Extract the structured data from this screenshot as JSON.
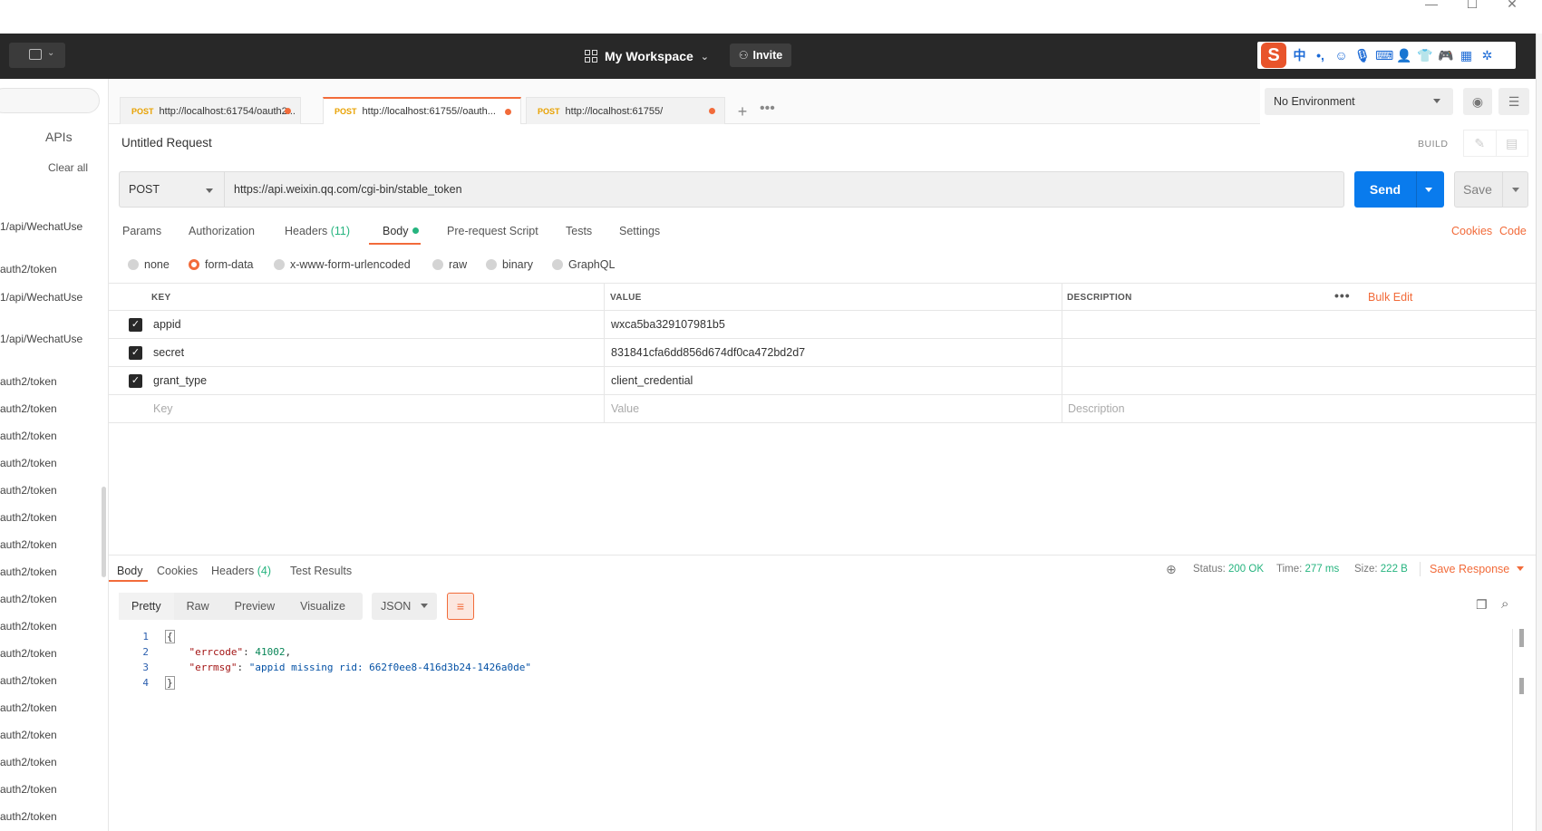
{
  "window": {
    "minimize": "—",
    "maximize": "☐",
    "close": "✕"
  },
  "header": {
    "workspace": "My Workspace",
    "invite": "Invite",
    "ime_items": [
      "中",
      "•,",
      "☺",
      "🎙",
      "⌨",
      "👤",
      "👕",
      "🎮",
      "▦",
      "✲"
    ]
  },
  "sidebar": {
    "apis": "APIs",
    "clear_all": "Clear all",
    "items": [
      "1/api/WechatUse",
      "auth2/token",
      "1/api/WechatUse",
      "1/api/WechatUse",
      "auth2/token",
      "auth2/token",
      "auth2/token",
      "auth2/token",
      "auth2/token",
      "auth2/token",
      "auth2/token",
      "auth2/token",
      "auth2/token",
      "auth2/token",
      "auth2/token",
      "auth2/token",
      "auth2/token",
      "auth2/token",
      "auth2/token",
      "auth2/token",
      "auth2/token"
    ]
  },
  "tabs": [
    {
      "method": "POST",
      "url": "http://localhost:61754/oauth2..."
    },
    {
      "method": "POST",
      "url": "http://localhost:61755//oauth..."
    },
    {
      "method": "POST",
      "url": "http://localhost:61755/"
    }
  ],
  "environment": {
    "selected": "No Environment"
  },
  "request": {
    "title": "Untitled Request",
    "build": "BUILD",
    "method": "POST",
    "url": "https://api.weixin.qq.com/cgi-bin/stable_token",
    "send": "Send",
    "save": "Save",
    "subtabs": {
      "params": "Params",
      "authorization": "Authorization",
      "headers": "Headers",
      "headers_count": "(11)",
      "body": "Body",
      "pre_request": "Pre-request Script",
      "tests": "Tests",
      "settings": "Settings"
    },
    "cookies": "Cookies",
    "code": "Code",
    "body_types": [
      "none",
      "form-data",
      "x-www-form-urlencoded",
      "raw",
      "binary",
      "GraphQL"
    ],
    "selected_body_type": "form-data"
  },
  "params_table": {
    "headers": {
      "key": "KEY",
      "value": "VALUE",
      "description": "DESCRIPTION"
    },
    "bulk_edit": "Bulk Edit",
    "rows": [
      {
        "checked": true,
        "key": "appid",
        "value": "wxca5ba329107981b5",
        "description": ""
      },
      {
        "checked": true,
        "key": "secret",
        "value": "831841cfa6dd856d674df0ca472bd2d7",
        "description": ""
      },
      {
        "checked": true,
        "key": "grant_type",
        "value": "client_credential",
        "description": ""
      }
    ],
    "placeholder": {
      "key": "Key",
      "value": "Value",
      "description": "Description"
    }
  },
  "response": {
    "tabs": {
      "body": "Body",
      "cookies": "Cookies",
      "headers": "Headers",
      "headers_count": "(4)",
      "test_results": "Test Results"
    },
    "status_label": "Status:",
    "status": "200 OK",
    "time_label": "Time:",
    "time": "277 ms",
    "size_label": "Size:",
    "size": "222 B",
    "save_response": "Save Response",
    "formats": [
      "Pretty",
      "Raw",
      "Preview",
      "Visualize"
    ],
    "language": "JSON",
    "code_lines": [
      {
        "n": "1",
        "text": "{"
      },
      {
        "n": "2",
        "key": "\"errcode\"",
        "val": "41002"
      },
      {
        "n": "3",
        "key": "\"errmsg\"",
        "val": "\"appid missing rid: 662f0ee8-416d3b24-1426a0de\""
      },
      {
        "n": "4",
        "text": "}"
      }
    ]
  }
}
